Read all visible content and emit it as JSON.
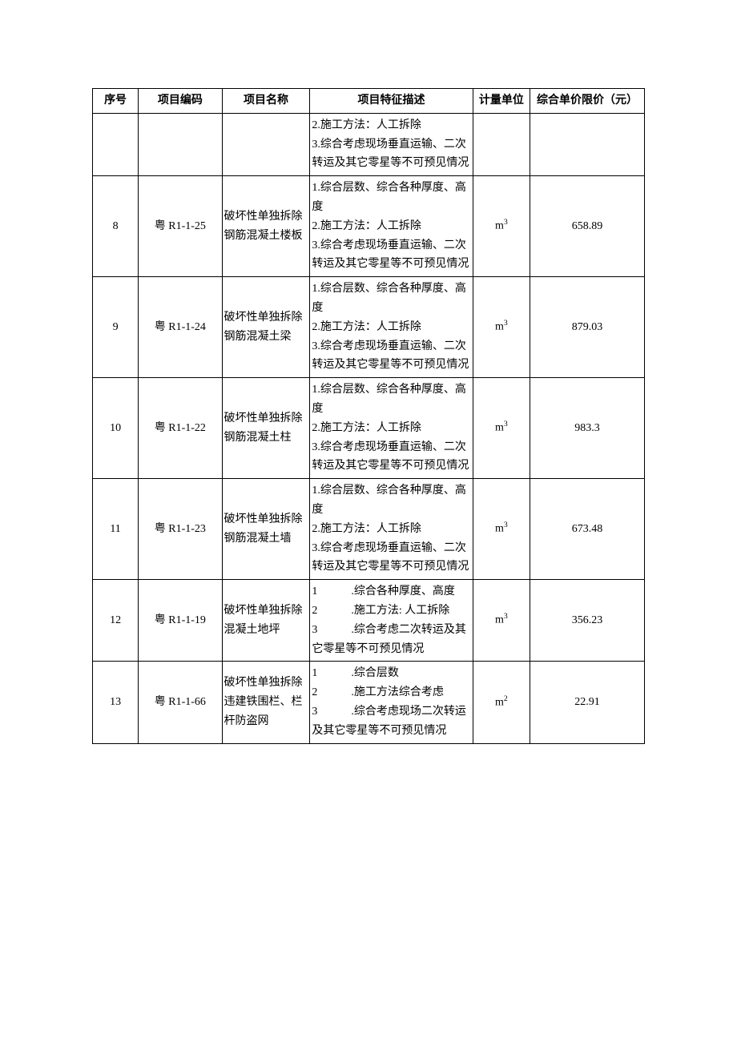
{
  "headers": {
    "seq": "序号",
    "code": "项目编码",
    "name": "项目名称",
    "desc": "项目特征描述",
    "unit": "计量单位",
    "price": "综合单价限价（元）"
  },
  "rows": [
    {
      "seq": "",
      "code": "",
      "name": "",
      "desc": "2.施工方法：人工拆除\n3.综合考虑现场垂直运输、二次转运及其它零星等不可预见情况",
      "unit": "",
      "price": ""
    },
    {
      "seq": "8",
      "code": "粤 R1-1-25",
      "name": "破坏性单独拆除钢筋混凝土楼板",
      "desc": "1.综合层数、综合各种厚度、高度\n2.施工方法：人工拆除\n3.综合考虑现场垂直运输、二次转运及其它零星等不可预见情况",
      "unit_base": "m",
      "unit_sup": "3",
      "price": "658.89"
    },
    {
      "seq": "9",
      "code": "粤 R1-1-24",
      "name": "破坏性单独拆除钢筋混凝土梁",
      "desc": "1.综合层数、综合各种厚度、高度\n2.施工方法：人工拆除\n3.综合考虑现场垂直运输、二次转运及其它零星等不可预见情况",
      "unit_base": "m",
      "unit_sup": "3",
      "price": "879.03"
    },
    {
      "seq": "10",
      "code": "粤 R1-1-22",
      "name": "破坏性单独拆除钢筋混凝土柱",
      "desc": "1.综合层数、综合各种厚度、高度\n2.施工方法：人工拆除\n3.综合考虑现场垂直运输、二次转运及其它零星等不可预见情况",
      "unit_base": "m",
      "unit_sup": "3",
      "price": "983.3"
    },
    {
      "seq": "11",
      "code": "粤 R1-1-23",
      "name": "破坏性单独拆除钢筋混凝土墙",
      "desc": "1.综合层数、综合各种厚度、高度\n2.施工方法：人工拆除\n3.综合考虑现场垂直运输、二次转运及其它零星等不可预见情况",
      "unit_base": "m",
      "unit_sup": "3",
      "price": "673.48"
    },
    {
      "seq": "12",
      "code": "粤 R1-1-19",
      "name": "破坏性单独拆除混凝土地坪",
      "desc": "1　　　.综合各种厚度、高度\n2　　　.施工方法: 人工拆除\n3　　　.综合考虑二次转运及其它零星等不可预见情况",
      "unit_base": "m",
      "unit_sup": "3",
      "price": "356.23"
    },
    {
      "seq": "13",
      "code": "粤 R1-1-66",
      "name": "破坏性单独拆除违建铁围栏、栏杆防盗网",
      "desc": "1　　　.综合层数\n2　　　.施工方法综合考虑\n3　　　.综合考虑现场二次转运及其它零星等不可预见情况",
      "unit_base": "m",
      "unit_sup": "2",
      "price": "22.91"
    }
  ]
}
